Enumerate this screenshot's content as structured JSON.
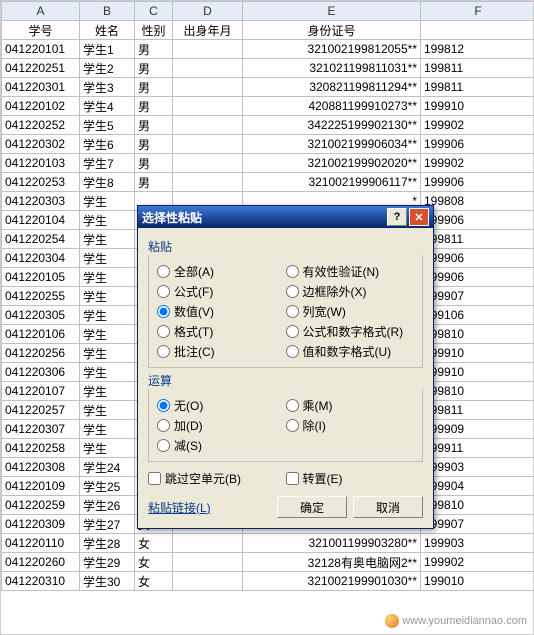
{
  "columns": [
    "A",
    "B",
    "C",
    "D",
    "E",
    "F"
  ],
  "header_row": {
    "A": "学号",
    "B": "姓名",
    "C": "性别",
    "D": "出身年月",
    "E": "身份证号",
    "F": ""
  },
  "rows": [
    {
      "A": "041220101",
      "B": "学生1",
      "C": "男",
      "D": "",
      "E": "321002199812055**",
      "F": "199812"
    },
    {
      "A": "041220251",
      "B": "学生2",
      "C": "男",
      "D": "",
      "E": "321021199811031**",
      "F": "199811"
    },
    {
      "A": "041220301",
      "B": "学生3",
      "C": "男",
      "D": "",
      "E": "320821199811294**",
      "F": "199811"
    },
    {
      "A": "041220102",
      "B": "学生4",
      "C": "男",
      "D": "",
      "E": "420881199910273**",
      "F": "199910"
    },
    {
      "A": "041220252",
      "B": "学生5",
      "C": "男",
      "D": "",
      "E": "342225199902130**",
      "F": "199902"
    },
    {
      "A": "041220302",
      "B": "学生6",
      "C": "男",
      "D": "",
      "E": "321002199906034**",
      "F": "199906"
    },
    {
      "A": "041220103",
      "B": "学生7",
      "C": "男",
      "D": "",
      "E": "321002199902020**",
      "F": "199902"
    },
    {
      "A": "041220253",
      "B": "学生8",
      "C": "男",
      "D": "",
      "E": "321002199906117**",
      "F": "199906"
    },
    {
      "A": "041220303",
      "B": "学生",
      "C": "",
      "D": "",
      "E": "*",
      "F": "199808"
    },
    {
      "A": "041220104",
      "B": "学生",
      "C": "",
      "D": "",
      "E": "*",
      "F": "199906"
    },
    {
      "A": "041220254",
      "B": "学生",
      "C": "",
      "D": "",
      "E": "*",
      "F": "199811"
    },
    {
      "A": "041220304",
      "B": "学生",
      "C": "",
      "D": "",
      "E": "*",
      "F": "199906"
    },
    {
      "A": "041220105",
      "B": "学生",
      "C": "",
      "D": "",
      "E": "*",
      "F": "199906"
    },
    {
      "A": "041220255",
      "B": "学生",
      "C": "",
      "D": "",
      "E": "*",
      "F": "199907"
    },
    {
      "A": "041220305",
      "B": "学生",
      "C": "",
      "D": "",
      "E": "*",
      "F": "199106"
    },
    {
      "A": "041220106",
      "B": "学生",
      "C": "",
      "D": "",
      "E": "*",
      "F": "199810"
    },
    {
      "A": "041220256",
      "B": "学生",
      "C": "",
      "D": "",
      "E": "*",
      "F": "199910"
    },
    {
      "A": "041220306",
      "B": "学生",
      "C": "",
      "D": "",
      "E": "*",
      "F": "199910"
    },
    {
      "A": "041220107",
      "B": "学生",
      "C": "",
      "D": "",
      "E": "*",
      "F": "199810"
    },
    {
      "A": "041220257",
      "B": "学生",
      "C": "",
      "D": "",
      "E": "*",
      "F": "199811"
    },
    {
      "A": "041220307",
      "B": "学生",
      "C": "",
      "D": "",
      "E": "*",
      "F": "199909"
    },
    {
      "A": "041220258",
      "B": "学生",
      "C": "",
      "D": "",
      "E": "*",
      "F": "199911"
    },
    {
      "A": "041220308",
      "B": "学生24",
      "C": "女",
      "D": "",
      "E": "321002199903237**",
      "F": "199903"
    },
    {
      "A": "041220109",
      "B": "学生25",
      "C": "女",
      "D": "",
      "E": "320829199904003**",
      "F": "199904"
    },
    {
      "A": "041220259",
      "B": "学生26",
      "C": "女",
      "D": "",
      "E": "320821199810083**",
      "F": "199810"
    },
    {
      "A": "041220309",
      "B": "学生27",
      "C": "女",
      "D": "",
      "E": "321002199907176**",
      "F": "199907"
    },
    {
      "A": "041220110",
      "B": "学生28",
      "C": "女",
      "D": "",
      "E": "321001199903280**",
      "F": "199903"
    },
    {
      "A": "041220260",
      "B": "学生29",
      "C": "女",
      "D": "",
      "E": "32128有奥电脑网2**",
      "F": "199902"
    },
    {
      "A": "041220310",
      "B": "学生30",
      "C": "女",
      "D": "",
      "E": "321002199901030**",
      "F": "199010"
    }
  ],
  "dialog": {
    "title": "选择性粘贴",
    "paste_label": "粘贴",
    "op_label": "运算",
    "left_paste": [
      {
        "label": "全部(A)",
        "sel": false
      },
      {
        "label": "公式(F)",
        "sel": false
      },
      {
        "label": "数值(V)",
        "sel": true
      },
      {
        "label": "格式(T)",
        "sel": false
      },
      {
        "label": "批注(C)",
        "sel": false
      }
    ],
    "right_paste": [
      {
        "label": "有效性验证(N)",
        "sel": false
      },
      {
        "label": "边框除外(X)",
        "sel": false
      },
      {
        "label": "列宽(W)",
        "sel": false
      },
      {
        "label": "公式和数字格式(R)",
        "sel": false
      },
      {
        "label": "值和数字格式(U)",
        "sel": false
      }
    ],
    "left_ops": [
      {
        "label": "无(O)",
        "sel": true
      },
      {
        "label": "加(D)",
        "sel": false
      },
      {
        "label": "减(S)",
        "sel": false
      }
    ],
    "right_ops": [
      {
        "label": "乘(M)",
        "sel": false
      },
      {
        "label": "除(I)",
        "sel": false
      }
    ],
    "skip_blanks": "跳过空单元(B)",
    "transpose": "转置(E)",
    "paste_link": "粘贴链接(L)",
    "ok": "确定",
    "cancel": "取消",
    "help": "?",
    "close": "✕"
  },
  "watermark": "www.youmeidiannao.com"
}
